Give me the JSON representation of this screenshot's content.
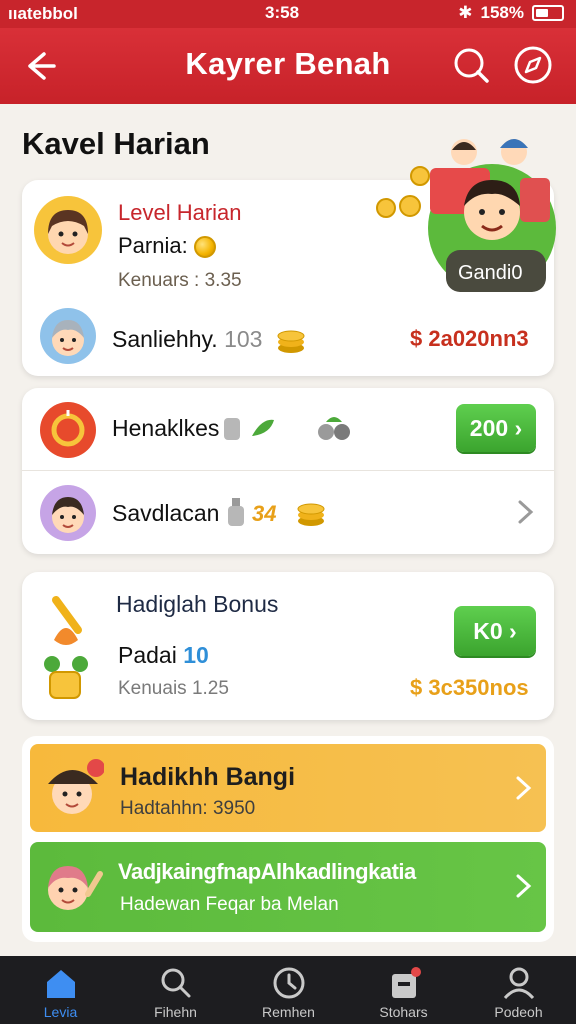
{
  "status_bar": {
    "carrier": "ııatebbol",
    "time": "3:58",
    "battery": "158%"
  },
  "app_bar": {
    "title": "Kayrer Benah"
  },
  "page": {
    "heading": "Kavel Harian"
  },
  "hero": {
    "badge": "Gandi0"
  },
  "level_card": {
    "title": "Level Harian",
    "line1": "Parnia:",
    "line2": "Kenuars : 3.35",
    "row_label": "Sanliehhy.",
    "row_value": "103",
    "amount": "$ 2a020nn3"
  },
  "list_card": {
    "row1_label": "Henaklkes",
    "row1_button": "200",
    "row2_label": "Savdlacan",
    "row2_value": "34"
  },
  "bonus_card": {
    "title": "Hadiglah Bonus",
    "line1_label": "Padai",
    "line1_value": "10",
    "line2": "Kenuais 1.25",
    "button": "K0",
    "amount": "$ 3c350nos"
  },
  "banners": [
    {
      "title": "Hadikhh Bangi",
      "subtitle": "Hadtahhn: 3950"
    },
    {
      "title": "VadjkaingfnapAlhkadlingkatia",
      "subtitle": "Hadewan Feqar ba Melan"
    }
  ],
  "tabs": [
    {
      "label": "Levia"
    },
    {
      "label": "Fihehn"
    },
    {
      "label": "Remhen"
    },
    {
      "label": "Stohars"
    },
    {
      "label": "Podeoh"
    }
  ],
  "colors": {
    "primary_red": "#c8252c",
    "green": "#45b236",
    "orange_banner": "#f7b93c",
    "green_banner": "#5cba3c",
    "active_tab": "#3e8ef2"
  }
}
